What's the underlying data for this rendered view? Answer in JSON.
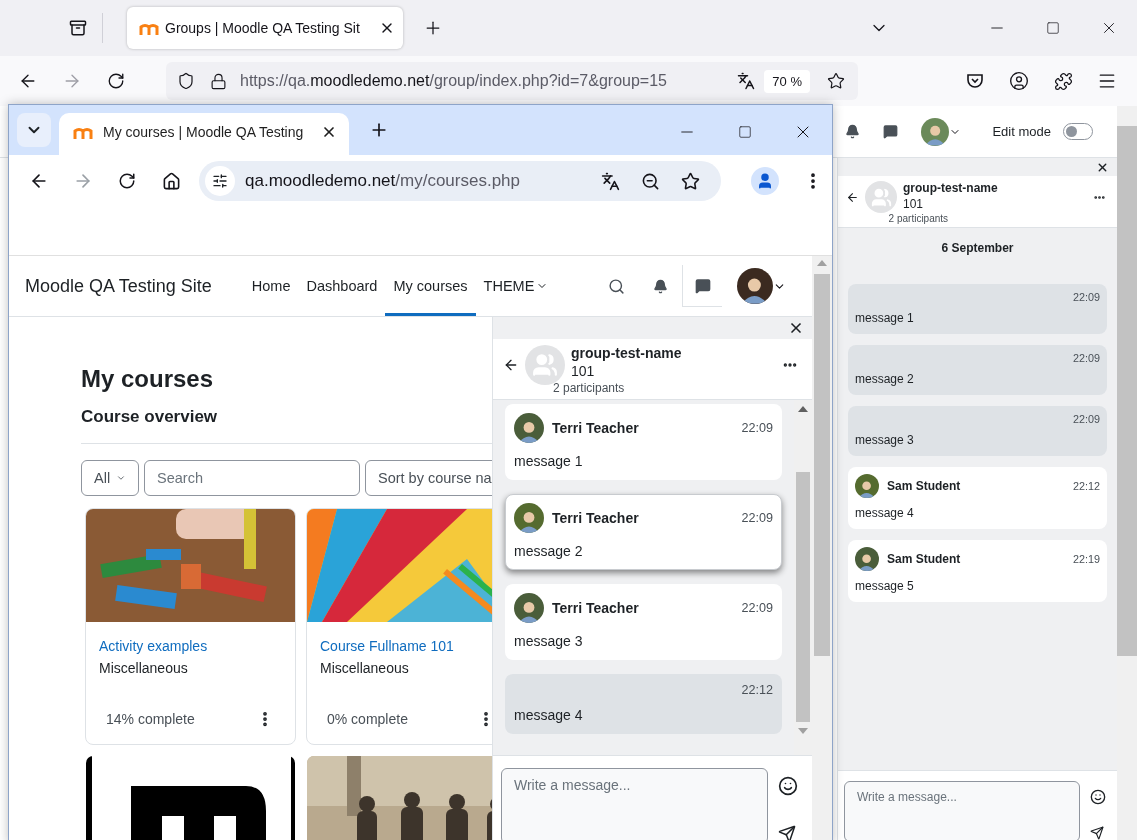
{
  "firefox": {
    "tab": {
      "title": "Groups | Moodle QA Testing Sit",
      "selected": true
    },
    "url": "https://qa.moodledemo.net/group/index.php?id=7&group=15",
    "zoom": "70 %",
    "page": {
      "edit_mode": {
        "label": "Edit mode",
        "on": false
      },
      "chat": {
        "group": {
          "name": "group-test-name",
          "subtitle": "101",
          "participants": "2 participants"
        },
        "date": "6 September",
        "messages": [
          {
            "kind": "sent",
            "time": "22:09",
            "text": "message 1"
          },
          {
            "kind": "sent",
            "time": "22:09",
            "text": "message 2"
          },
          {
            "kind": "sent",
            "time": "22:09",
            "text": "message 3"
          },
          {
            "kind": "received",
            "sender": "Sam Student",
            "time": "22:12",
            "text": "message 4"
          },
          {
            "kind": "received",
            "sender": "Sam Student",
            "time": "22:19",
            "text": "message 5"
          }
        ],
        "composer": {
          "placeholder": "Write a message..."
        }
      }
    }
  },
  "chrome": {
    "tab": {
      "title": "My courses | Moodle QA Testing",
      "selected": true
    },
    "url": "qa.moodledemo.net/my/courses.php",
    "page": {
      "site_name": "Moodle QA Testing Site",
      "nav": [
        {
          "label": "Home",
          "selected": false
        },
        {
          "label": "Dashboard",
          "selected": false
        },
        {
          "label": "My courses",
          "selected": true
        },
        {
          "label": "THEME",
          "selected": false,
          "dropdown": true
        }
      ],
      "heading": "My courses",
      "subheading": "Course overview",
      "filter": "All",
      "search": {
        "placeholder": "Search"
      },
      "sort": "Sort by course na",
      "courses": [
        {
          "name": "Activity examples",
          "category": "Miscellaneous",
          "progress": "14% complete"
        },
        {
          "name": "Course Fullname 101",
          "category": "Miscellaneous",
          "progress": "0% complete"
        },
        {
          "kind": "picture"
        },
        {
          "kind": "picture"
        }
      ],
      "chat": {
        "group": {
          "name": "group-test-name",
          "subtitle": "101",
          "participants": "2 participants"
        },
        "messages": [
          {
            "kind": "received",
            "sender": "Terri Teacher",
            "time": "22:09",
            "text": "message 1",
            "hovered": false
          },
          {
            "kind": "received",
            "sender": "Terri Teacher",
            "time": "22:09",
            "text": "message 2",
            "hovered": true
          },
          {
            "kind": "received",
            "sender": "Terri Teacher",
            "time": "22:09",
            "text": "message 3",
            "hovered": false
          },
          {
            "kind": "sent",
            "time": "22:12",
            "text": "message 4",
            "hovered": false
          }
        ],
        "composer": {
          "placeholder": "Write a message..."
        }
      }
    }
  }
}
